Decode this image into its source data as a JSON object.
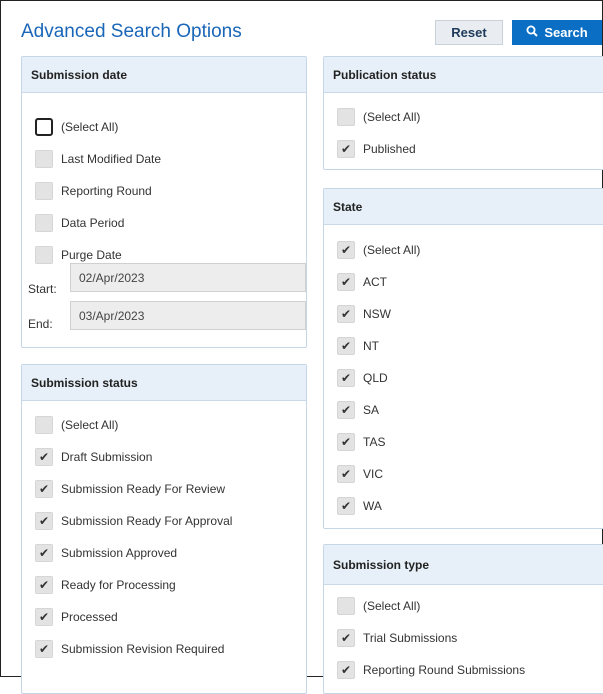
{
  "header": {
    "title": "Advanced Search Options",
    "reset_label": "Reset",
    "search_label": "Search"
  },
  "submission_date": {
    "title": "Submission date",
    "items": [
      {
        "label": "(Select All)",
        "checked": false
      },
      {
        "label": "Last Modified Date",
        "checked": false
      },
      {
        "label": "Reporting Round",
        "checked": false
      },
      {
        "label": "Data Period",
        "checked": false
      },
      {
        "label": "Purge Date",
        "checked": false
      }
    ],
    "start_label": "Start:",
    "start_value": "02/Apr/2023",
    "end_label": "End:",
    "end_value": "03/Apr/2023"
  },
  "submission_status": {
    "title": "Submission status",
    "items": [
      {
        "label": "(Select All)",
        "checked": false
      },
      {
        "label": "Draft Submission",
        "checked": true
      },
      {
        "label": "Submission Ready For Review",
        "checked": true
      },
      {
        "label": "Submission Ready For Approval",
        "checked": true
      },
      {
        "label": "Submission Approved",
        "checked": true
      },
      {
        "label": "Ready for Processing",
        "checked": true
      },
      {
        "label": "Processed",
        "checked": true
      },
      {
        "label": "Submission Revision Required",
        "checked": true
      }
    ]
  },
  "publication_status": {
    "title": "Publication status",
    "items": [
      {
        "label": "(Select All)",
        "checked": false
      },
      {
        "label": "Published",
        "checked": true
      }
    ]
  },
  "state": {
    "title": "State",
    "items": [
      {
        "label": "(Select All)",
        "checked": true
      },
      {
        "label": "ACT",
        "checked": true
      },
      {
        "label": "NSW",
        "checked": true
      },
      {
        "label": "NT",
        "checked": true
      },
      {
        "label": "QLD",
        "checked": true
      },
      {
        "label": "SA",
        "checked": true
      },
      {
        "label": "TAS",
        "checked": true
      },
      {
        "label": "VIC",
        "checked": true
      },
      {
        "label": "WA",
        "checked": true
      }
    ]
  },
  "submission_type": {
    "title": "Submission type",
    "items": [
      {
        "label": "(Select All)",
        "checked": false
      },
      {
        "label": "Trial Submissions",
        "checked": true
      },
      {
        "label": "Reporting Round Submissions",
        "checked": true
      }
    ]
  },
  "glyphs": {
    "check": "✔",
    "search": "🔍"
  },
  "colors": {
    "accent": "#0a6ec4",
    "title": "#1a66b8",
    "panel_header": "#e7f0f8"
  }
}
